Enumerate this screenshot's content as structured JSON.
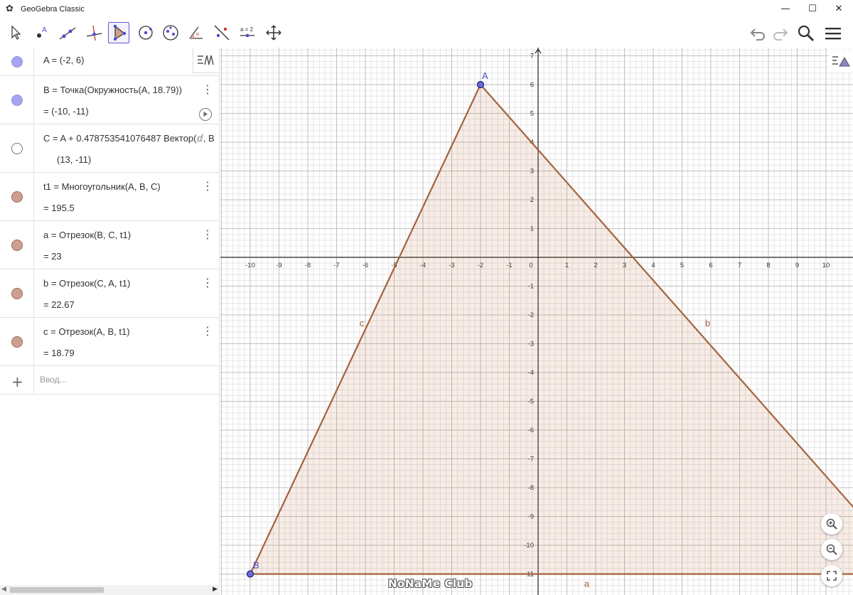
{
  "window": {
    "title": "GeoGebra Classic",
    "controls": {
      "minimize": "—",
      "maximize": "☐",
      "close": "✕"
    }
  },
  "toolbar": {
    "tools": [
      {
        "name": "move-tool",
        "icon": "arrow-cursor-icon"
      },
      {
        "name": "point-tool",
        "icon": "point-icon"
      },
      {
        "name": "line-tool",
        "icon": "line-icon"
      },
      {
        "name": "perpendicular-line-tool",
        "icon": "perpendicular-icon"
      },
      {
        "name": "polygon-tool",
        "icon": "polygon-icon",
        "selected": true
      },
      {
        "name": "circle-tool",
        "icon": "circle-center-icon"
      },
      {
        "name": "ellipse-tool",
        "icon": "ellipse-icon"
      },
      {
        "name": "angle-tool",
        "icon": "angle-icon"
      },
      {
        "name": "reflect-tool",
        "icon": "reflect-icon"
      },
      {
        "name": "slider-tool",
        "icon": "slider-icon",
        "label": "a = 2"
      },
      {
        "name": "move-graphics-tool",
        "icon": "move-arrows-icon"
      }
    ],
    "right": [
      "undo-icon",
      "redo-icon",
      "search-icon",
      "menu-icon"
    ]
  },
  "algebra": {
    "rows": [
      {
        "id": "A",
        "def": "A  =  (-2, 6)",
        "val": "",
        "marble": "#a5a5f0",
        "border": "#9292d8"
      },
      {
        "id": "B",
        "def": "B  =  Точка(Окружность(A, 18.79))",
        "val": "=   (-10, -11)",
        "marble": "#a5a5f0",
        "border": "#9292d8"
      },
      {
        "id": "C",
        "def": "C  =  A + 0.478753541076487 Вектор(",
        "def_tail": ", B",
        "val": "(13, -11)",
        "marble": "#ffffff",
        "border": "#777777"
      },
      {
        "id": "t1",
        "def": "t1  =  Многоугольник(A, B, C)",
        "val": "=   195.5",
        "marble": "#cc9f8e",
        "border": "#9a6c5c"
      },
      {
        "id": "a",
        "def": "a  =  Отрезок(B, C, t1)",
        "val": "=   23",
        "marble": "#cc9f8e",
        "border": "#9a6c5c"
      },
      {
        "id": "b",
        "def": "b  =  Отрезок(C, A, t1)",
        "val": "=   22.67",
        "marble": "#cc9f8e",
        "border": "#9a6c5c"
      },
      {
        "id": "c",
        "def": "c  =  Отрезок(A, B, t1)",
        "val": "=   18.79",
        "marble": "#cc9f8e",
        "border": "#9a6c5c"
      }
    ],
    "input_placeholder": "Ввод...",
    "add_symbol": "+"
  },
  "graphics": {
    "x_ticks": [
      "-10",
      "-9",
      "-8",
      "-7",
      "-6",
      "-5",
      "-4",
      "-3",
      "-2",
      "-1",
      "0",
      "1",
      "2",
      "3",
      "4",
      "5",
      "6",
      "7",
      "8",
      "9",
      "10"
    ],
    "y_ticks": [
      "7",
      "6",
      "5",
      "4",
      "3",
      "2",
      "1",
      "-1",
      "-2",
      "-3",
      "-4",
      "-5",
      "-6",
      "-7",
      "-8",
      "-9",
      "-10",
      "-11"
    ],
    "points": [
      {
        "label": "A",
        "x": -2,
        "y": 6
      },
      {
        "label": "B",
        "x": -10,
        "y": -11
      }
    ],
    "polygon": {
      "vertices": [
        [
          -2,
          6
        ],
        [
          -10,
          -11
        ],
        [
          13,
          -11
        ]
      ],
      "fill": "#c8633a",
      "stroke": "#a3633e"
    },
    "segment_labels": [
      "a",
      "b",
      "c"
    ],
    "watermark": "NoNaMe Club"
  },
  "colors": {
    "accent": "#6557d2",
    "segment": "#a3633e",
    "point": "#4b4bd4",
    "grid_major": "#c0c0c0",
    "grid_minor": "#e6e6e6"
  }
}
